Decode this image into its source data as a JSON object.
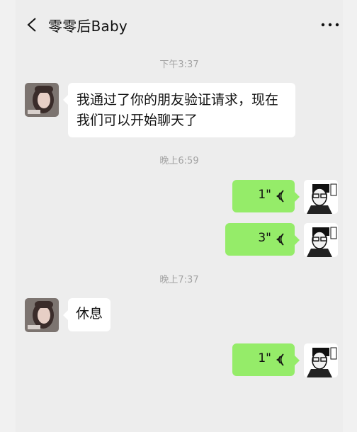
{
  "header": {
    "title": "零零后Baby"
  },
  "timestamps": [
    "下午3:37",
    "晚上6:59",
    "晚上7:37"
  ],
  "messages": {
    "friend_verified": "我通过了你的朋友验证请求，现在我们可以开始聊天了",
    "rest": "休息"
  },
  "voice": {
    "durations": [
      "1\"",
      "3\"",
      "1\""
    ]
  },
  "icons": {
    "back": "chevron-left-icon",
    "more": "more-dots-icon",
    "voice": "voice-wave-icon"
  },
  "colors": {
    "outgoing_bubble": "#95ec69",
    "incoming_bubble": "#ffffff",
    "background": "#ededed"
  }
}
